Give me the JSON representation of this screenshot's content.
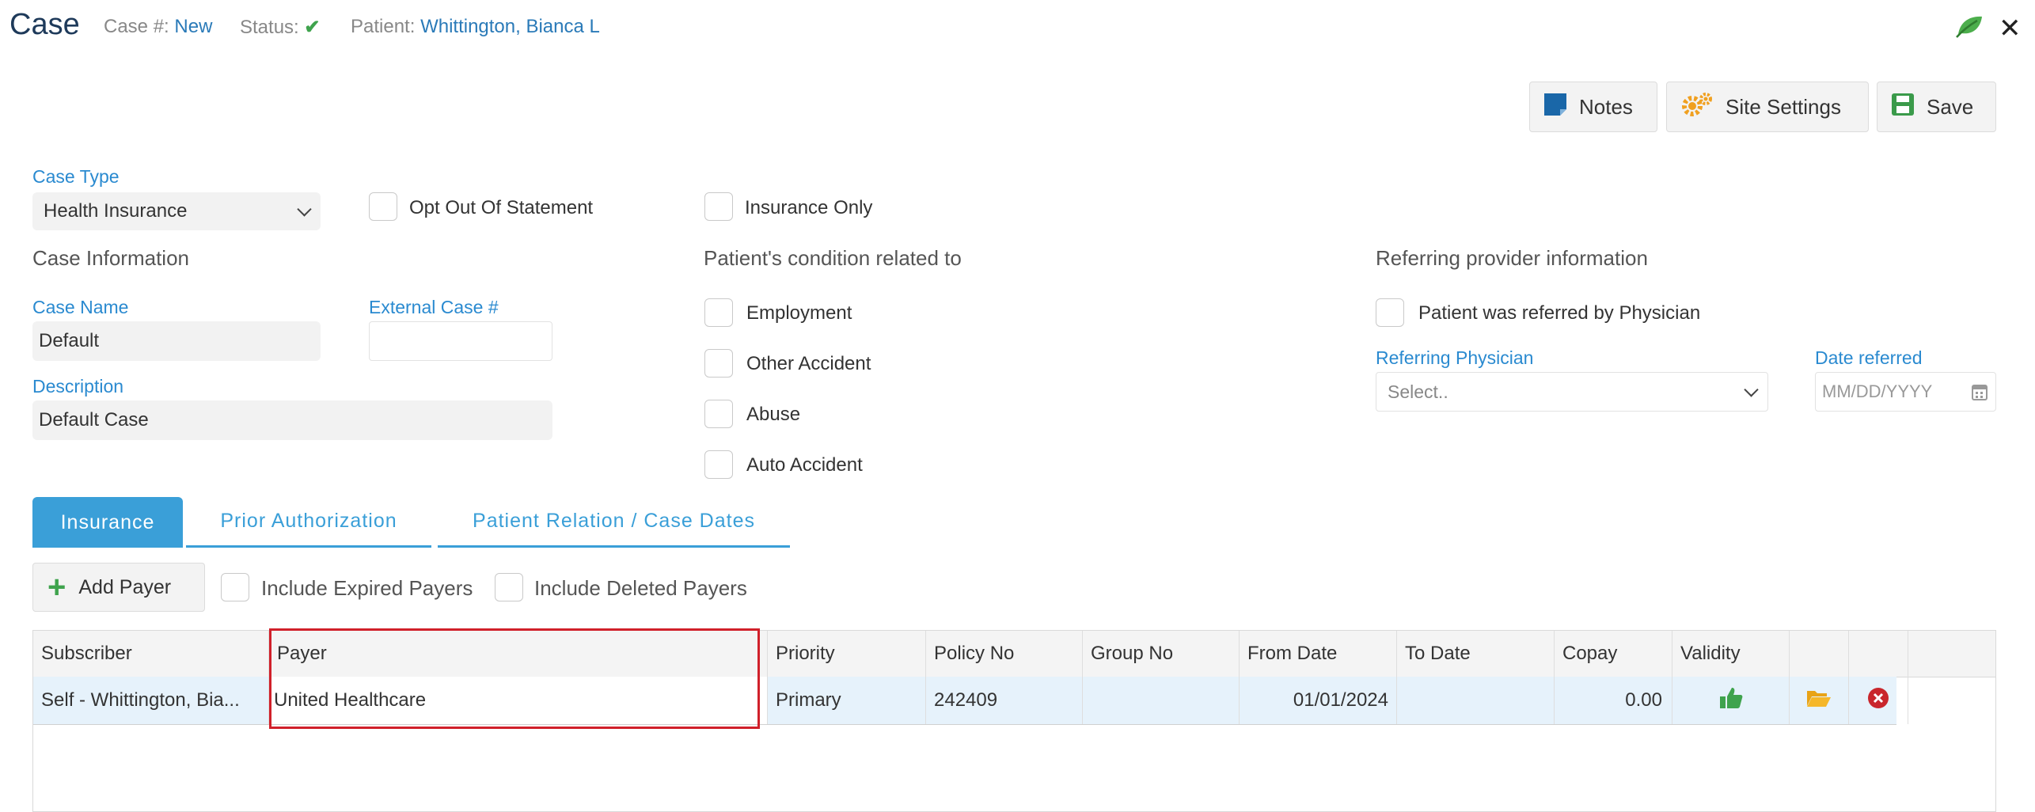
{
  "header": {
    "title": "Case",
    "case_num_label": "Case #:",
    "case_num_value": "New",
    "status_label": "Status:",
    "patient_label": "Patient:",
    "patient_value": "Whittington, Bianca L"
  },
  "toolbar": {
    "notes": "Notes",
    "site_settings": "Site Settings",
    "save": "Save"
  },
  "form": {
    "case_type_label": "Case Type",
    "case_type_value": "Health Insurance",
    "opt_out_label": "Opt Out Of Statement",
    "insurance_only_label": "Insurance Only",
    "case_info_heading": "Case Information",
    "case_name_label": "Case Name",
    "case_name_value": "Default",
    "external_case_label": "External Case #",
    "description_label": "Description",
    "description_value": "Default Case",
    "condition_heading": "Patient's condition related to",
    "conditions": [
      "Employment",
      "Other Accident",
      "Abuse",
      "Auto Accident"
    ],
    "referring_heading": "Referring provider information",
    "referred_label": "Patient was referred by Physician",
    "referring_physician_label": "Referring Physician",
    "referring_physician_placeholder": "Select..",
    "date_referred_label": "Date referred",
    "date_referred_placeholder": "MM/DD/YYYY"
  },
  "tabs": [
    "Insurance",
    "Prior Authorization",
    "Patient Relation / Case Dates"
  ],
  "payers": {
    "add_payer": "Add Payer",
    "include_expired": "Include Expired Payers",
    "include_deleted": "Include Deleted Payers",
    "columns": [
      "Subscriber",
      "Payer",
      "Priority",
      "Policy No",
      "Group No",
      "From Date",
      "To Date",
      "Copay",
      "Validity"
    ],
    "rows": [
      {
        "subscriber": "Self - Whittington, Bia...",
        "payer": "United Healthcare",
        "priority": "Primary",
        "policy_no": "242409",
        "group_no": "",
        "from_date": "01/01/2024",
        "to_date": "",
        "copay": "0.00"
      }
    ]
  },
  "colors": {
    "accent": "#3a9fd8",
    "link": "#2a7ab8",
    "status_green": "#3fa34d",
    "highlight_red": "#d0202a"
  }
}
